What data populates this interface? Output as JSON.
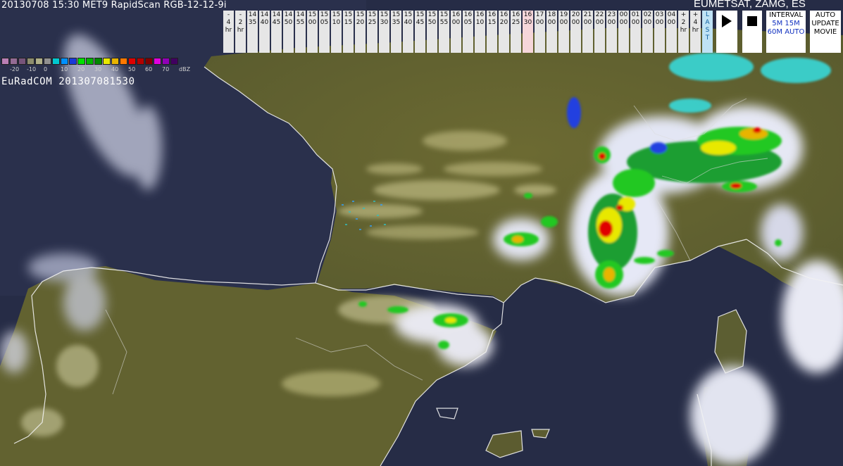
{
  "header": {
    "title": "20130708 15:30 MET9 RapidScan RGB-12-12-9i",
    "credit": "EUMETSAT, ZAMG, ES"
  },
  "stamp": "EuRadCOM 201307081530",
  "legend": {
    "labels": [
      "-20",
      "-10",
      "0",
      "10",
      "20",
      "30",
      "40",
      "50",
      "60",
      "70",
      "dBZ"
    ],
    "colors": [
      "#b97fb5",
      "#936b94",
      "#76547a",
      "#8e8e6e",
      "#b0b08a",
      "#909090",
      "#00c8d0",
      "#0090ff",
      "#1a3ad8",
      "#00e000",
      "#00b400",
      "#008800",
      "#e8e800",
      "#e8b400",
      "#ff7800",
      "#e00000",
      "#b40000",
      "#800000",
      "#e000e0",
      "#9000b8",
      "#400060"
    ]
  },
  "timebar": [
    {
      "lines": [
        "-",
        "4",
        "hr"
      ]
    },
    {
      "lines": [
        "-",
        "2",
        "hr"
      ]
    },
    {
      "lines": [
        "14",
        "35"
      ]
    },
    {
      "lines": [
        "14",
        "40"
      ]
    },
    {
      "lines": [
        "14",
        "45"
      ]
    },
    {
      "lines": [
        "14",
        "50"
      ]
    },
    {
      "lines": [
        "14",
        "55"
      ]
    },
    {
      "lines": [
        "15",
        "00"
      ]
    },
    {
      "lines": [
        "15",
        "05"
      ]
    },
    {
      "lines": [
        "15",
        "10"
      ]
    },
    {
      "lines": [
        "15",
        "15"
      ]
    },
    {
      "lines": [
        "15",
        "20"
      ]
    },
    {
      "lines": [
        "15",
        "25"
      ]
    },
    {
      "lines": [
        "15",
        "30"
      ]
    },
    {
      "lines": [
        "15",
        "35"
      ]
    },
    {
      "lines": [
        "15",
        "40"
      ]
    },
    {
      "lines": [
        "15",
        "45"
      ]
    },
    {
      "lines": [
        "15",
        "50"
      ]
    },
    {
      "lines": [
        "15",
        "55"
      ]
    },
    {
      "lines": [
        "16",
        "00"
      ]
    },
    {
      "lines": [
        "16",
        "05"
      ]
    },
    {
      "lines": [
        "16",
        "10"
      ]
    },
    {
      "lines": [
        "16",
        "15"
      ]
    },
    {
      "lines": [
        "16",
        "20"
      ]
    },
    {
      "lines": [
        "16",
        "25"
      ]
    },
    {
      "lines": [
        "16",
        "30"
      ],
      "current": true
    },
    {
      "lines": [
        "17",
        "00"
      ]
    },
    {
      "lines": [
        "18",
        "00"
      ]
    },
    {
      "lines": [
        "19",
        "00"
      ]
    },
    {
      "lines": [
        "20",
        "00"
      ]
    },
    {
      "lines": [
        "21",
        "00"
      ]
    },
    {
      "lines": [
        "22",
        "00"
      ]
    },
    {
      "lines": [
        "23",
        "00"
      ]
    },
    {
      "lines": [
        "00",
        "00"
      ]
    },
    {
      "lines": [
        "01",
        "00"
      ]
    },
    {
      "lines": [
        "02",
        "00"
      ]
    },
    {
      "lines": [
        "03",
        "00"
      ]
    },
    {
      "lines": [
        "04",
        "00"
      ]
    },
    {
      "lines": [
        "+",
        "2",
        "hr"
      ]
    },
    {
      "lines": [
        "+",
        "4",
        "hr"
      ]
    },
    {
      "lines": [
        "L",
        "A",
        "S",
        "T"
      ],
      "last": true
    }
  ],
  "controls": {
    "interval_label": "INTERVAL",
    "interval_5m": "5M",
    "interval_15m": "15M",
    "interval_60m": "60M",
    "interval_auto": "AUTO",
    "auto_label": "AUTO",
    "update_label": "UPDATE",
    "movie_label": "MOVIE"
  }
}
